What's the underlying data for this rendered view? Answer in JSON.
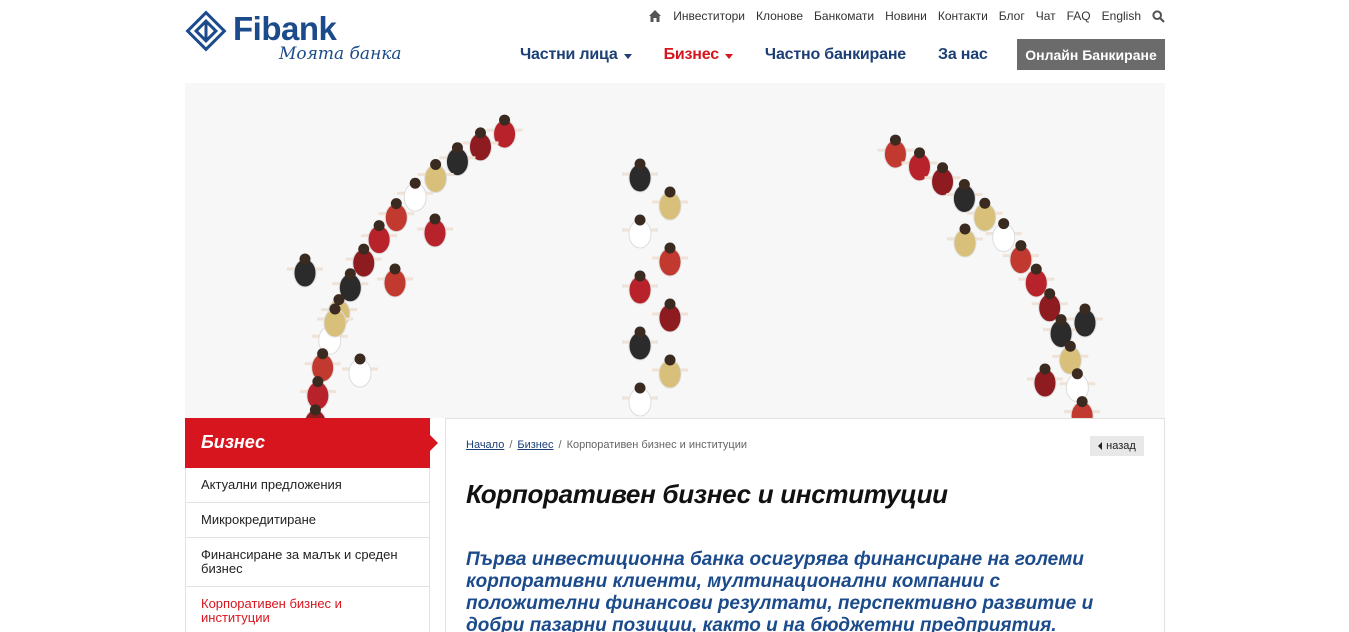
{
  "brand": {
    "name": "Fibank",
    "tagline": "Моята банка",
    "primary_color": "#1c4b8c",
    "accent_color": "#d7151e"
  },
  "topnav": {
    "items": [
      "Инвеститори",
      "Клонове",
      "Банкомати",
      "Новини",
      "Контакти",
      "Блог",
      "Чат",
      "FAQ",
      "English"
    ]
  },
  "mainnav": {
    "items": [
      {
        "label": "Частни лица"
      },
      {
        "label": "Бизнес"
      },
      {
        "label": "Частно банкиране"
      },
      {
        "label": "За нас"
      }
    ],
    "online_banking": "Онлайн Банкиране"
  },
  "sidebar": {
    "title": "Бизнес",
    "items": [
      {
        "label": "Актуални предложения"
      },
      {
        "label": "Микрокредитиране"
      },
      {
        "label": "Финансиране за малък и среден бизнес"
      },
      {
        "label": "Корпоративен бизнес и институции"
      }
    ]
  },
  "breadcrumb": {
    "home": "Начало",
    "section": "Бизнес",
    "current": "Корпоративен бизнес и институции"
  },
  "back_label": "назад",
  "page": {
    "title": "Корпоративен бизнес и институции",
    "lead": "Първа инвестиционна банка осигурява финансиране на големи корпоративни клиенти, мултинационални компании с положителни финансови резултати, перспективно развитие и добри пазарни позиции, както и на бюджетни предприятия."
  }
}
